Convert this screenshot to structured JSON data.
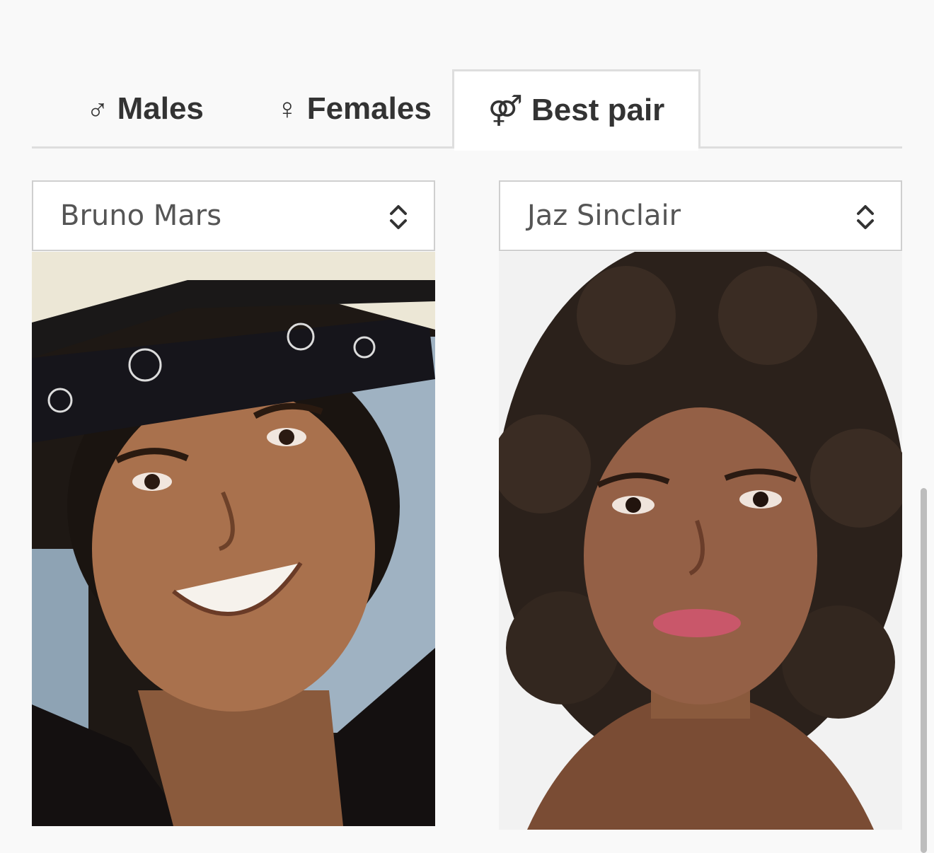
{
  "tabs": [
    {
      "icon": "male-icon",
      "glyph": "♂",
      "label": "Males",
      "active": false
    },
    {
      "icon": "female-icon",
      "glyph": "♀",
      "label": "Females",
      "active": false
    },
    {
      "icon": "pair-icon",
      "glyph": "⚤",
      "label": "Best pair",
      "active": true
    }
  ],
  "left": {
    "selected": "Bruno Mars"
  },
  "right": {
    "selected": "Jaz Sinclair"
  }
}
